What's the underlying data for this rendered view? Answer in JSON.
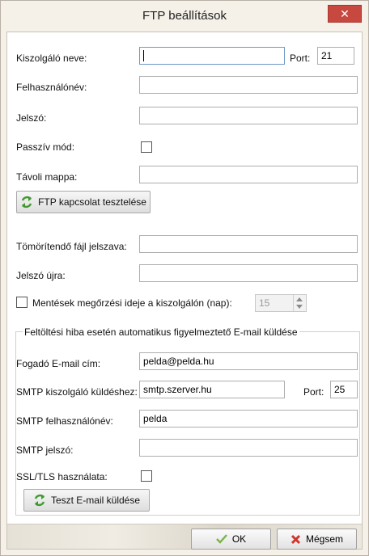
{
  "window": {
    "title": "FTP beállítások",
    "close_glyph": "✕"
  },
  "ftp": {
    "server_label": "Kiszolgáló neve:",
    "server_value": "",
    "port_label": "Port:",
    "port_value": "21",
    "user_label": "Felhasználónév:",
    "user_value": "",
    "password_label": "Jelszó:",
    "password_value": "",
    "passive_label": "Passzív mód:",
    "remote_folder_label": "Távoli mappa:",
    "remote_folder_value": "",
    "test_button_label": "FTP kapcsolat tesztelése"
  },
  "archive": {
    "password_label": "Tömörítendő fájl jelszava:",
    "password_value": "",
    "password_again_label": "Jelszó újra:",
    "password_again_value": "",
    "retention_label": "Mentések megőrzési ideje  a kiszolgálón (nap):",
    "retention_value": "15"
  },
  "email": {
    "group_title": "Feltöltési hiba esetén automatikus figyelmeztető E-mail küldése",
    "recipient_label": "Fogadó E-mail cím:",
    "recipient_value": "pelda@pelda.hu",
    "smtp_server_label": "SMTP kiszolgáló küldéshez:",
    "smtp_server_value": "smtp.szerver.hu",
    "smtp_port_label": "Port:",
    "smtp_port_value": "25",
    "smtp_user_label": "SMTP felhasználónév:",
    "smtp_user_value": "pelda",
    "smtp_password_label": "SMTP jelszó:",
    "smtp_password_value": "",
    "ssl_label": "SSL/TLS használata:",
    "test_button_label": "Teszt E-mail küldése"
  },
  "footer": {
    "ok_label": "OK",
    "cancel_label": "Mégsem"
  },
  "colors": {
    "accent_green": "#3f9a2e",
    "cancel_red": "#d0342c",
    "close_red": "#c7483f"
  },
  "icons": [
    "refresh-icon",
    "check-icon",
    "x-icon",
    "close-icon"
  ]
}
